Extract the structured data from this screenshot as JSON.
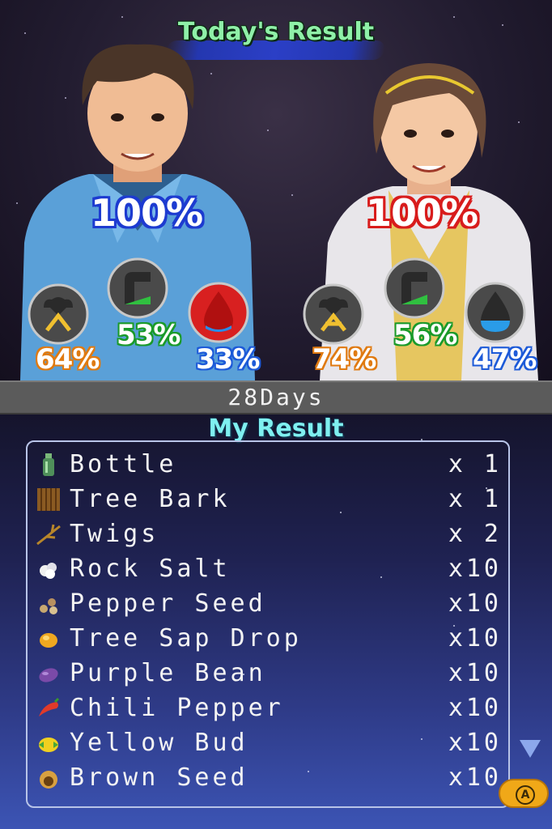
{
  "top_screen": {
    "title": "Today's Result",
    "male": {
      "overall": "100%",
      "stamina": "64%",
      "food": "53%",
      "water": "33%",
      "colors": {
        "overall": "#1d3bd0",
        "water": "#d82020"
      }
    },
    "female": {
      "overall": "100%",
      "stamina": "74%",
      "food": "56%",
      "water": "47%",
      "colors": {
        "overall": "#d81c1c",
        "water": "#2a8ce8"
      }
    }
  },
  "days_label": "28Days",
  "bottom_screen": {
    "title": "My Result",
    "items": [
      {
        "name": "Bottle",
        "qty": "x 1",
        "icon": "bottle-icon"
      },
      {
        "name": "Tree Bark",
        "qty": "x 1",
        "icon": "tree-bark-icon"
      },
      {
        "name": "Twigs",
        "qty": "x 2",
        "icon": "twigs-icon"
      },
      {
        "name": "Rock Salt",
        "qty": "x10",
        "icon": "rock-salt-icon"
      },
      {
        "name": "Pepper Seed",
        "qty": "x10",
        "icon": "pepper-seed-icon"
      },
      {
        "name": "Tree Sap Drop",
        "qty": "x10",
        "icon": "tree-sap-icon"
      },
      {
        "name": "Purple Bean",
        "qty": "x10",
        "icon": "purple-bean-icon"
      },
      {
        "name": "Chili Pepper",
        "qty": "x10",
        "icon": "chili-pepper-icon"
      },
      {
        "name": "Yellow Bud",
        "qty": "x10",
        "icon": "yellow-bud-icon"
      },
      {
        "name": "Brown Seed",
        "qty": "x10",
        "icon": "brown-seed-icon"
      }
    ],
    "confirm_button": "A"
  }
}
